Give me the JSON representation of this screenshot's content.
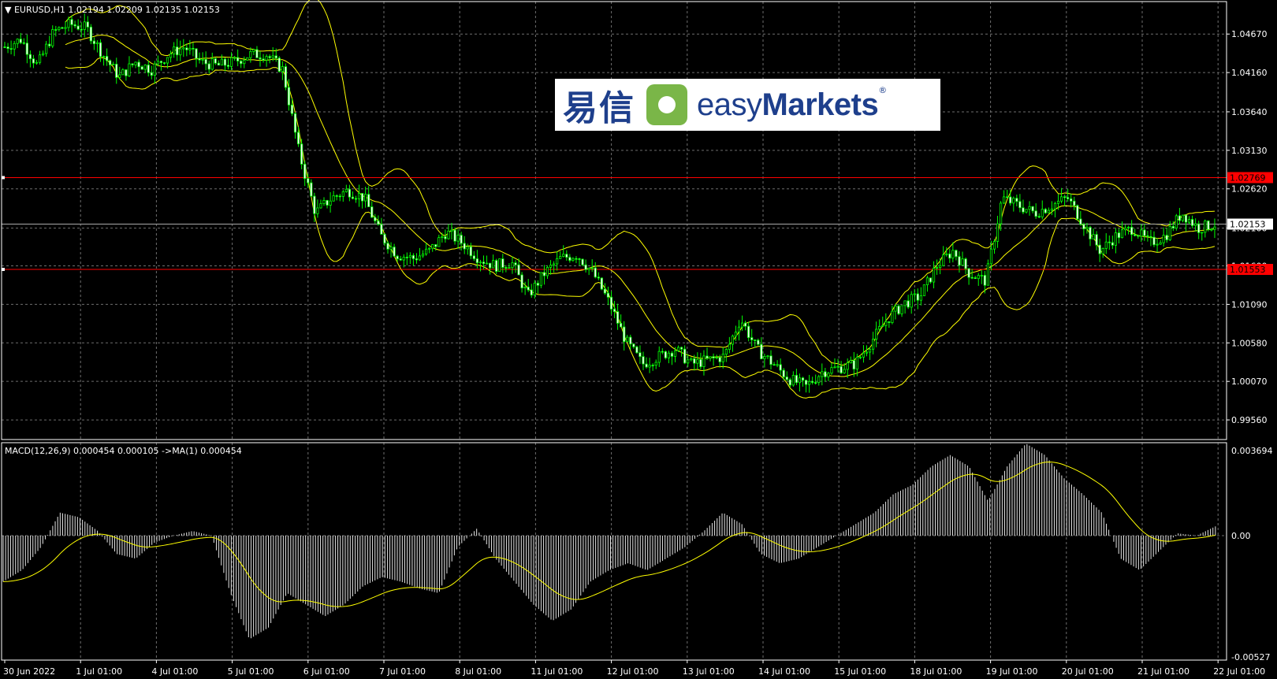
{
  "window": {
    "symbol_title": "EURUSD,H1",
    "ohlc": "1.02194 1.02209 1.02135 1.02153"
  },
  "logo": {
    "brand_cn": "易信",
    "brand_en_a": "easy",
    "brand_en_b": "Markets",
    "reg": "®"
  },
  "chart_data": [
    {
      "type": "candlestick",
      "title": "EURUSD,H1",
      "y_ticks": [
        "1.04670",
        "1.04160",
        "1.03640",
        "1.03130",
        "1.02620",
        "1.02100",
        "1.01600",
        "1.01090",
        "1.00580",
        "1.00070",
        "0.99560"
      ],
      "ylim": [
        0.993,
        1.051
      ],
      "current_price": "1.02153",
      "hlines": [
        {
          "value": 1.02769,
          "label": "1.02769",
          "color": "#ff0000"
        },
        {
          "value": 1.01553,
          "label": "1.01553",
          "color": "#ff0000"
        }
      ],
      "x_ticks": [
        "30 Jun 2022",
        "1 Jul 01:00",
        "4 Jul 01:00",
        "5 Jul 01:00",
        "6 Jul 01:00",
        "7 Jul 01:00",
        "8 Jul 01:00",
        "11 Jul 01:00",
        "12 Jul 01:00",
        "13 Jul 01:00",
        "14 Jul 01:00",
        "15 Jul 01:00",
        "18 Jul 01:00",
        "19 Jul 01:00",
        "20 Jul 01:00",
        "21 Jul 01:00",
        "22 Jul 01:00"
      ],
      "price_path": [
        1.045,
        1.046,
        1.0425,
        1.047,
        1.048,
        1.0475,
        1.044,
        1.041,
        1.043,
        1.042,
        1.044,
        1.045,
        1.043,
        1.0425,
        1.043,
        1.044,
        1.044,
        1.042,
        1.031,
        1.023,
        1.025,
        1.026,
        1.025,
        1.02,
        1.0175,
        1.017,
        1.018,
        1.0205,
        1.019,
        1.017,
        1.016,
        1.0165,
        1.012,
        1.015,
        1.017,
        1.0175,
        1.015,
        1.011,
        1.006,
        1.003,
        1.004,
        1.005,
        1.003,
        1.0035,
        1.004,
        1.009,
        1.005,
        1.003,
        1.001,
        1.0,
        1.002,
        1.0025,
        1.003,
        1.006,
        1.009,
        1.011,
        1.012,
        1.016,
        1.018,
        1.015,
        1.014,
        1.025,
        1.024,
        1.023,
        1.024,
        1.025,
        1.0215,
        1.018,
        1.02,
        1.021,
        1.019,
        1.02,
        1.023,
        1.021,
        1.0215
      ],
      "series": [
        {
          "name": "Bollinger Bands",
          "color": "#ffff00"
        }
      ]
    },
    {
      "type": "histogram",
      "title": "MACD(12,26,9) 0.000454 0.000105 ->MA(1) 0.000454",
      "y_ticks": [
        "0.003694",
        "0.00",
        "-0.00527"
      ],
      "ylim": [
        -0.00527,
        0.003694
      ],
      "macd_path": [
        -0.002,
        -0.0015,
        -0.0005,
        0.001,
        0.0008,
        0.0002,
        -0.0008,
        -0.001,
        -0.0003,
        0.0,
        0.0002,
        0.0,
        -0.0025,
        -0.0045,
        -0.004,
        -0.0025,
        -0.003,
        -0.0035,
        -0.003,
        -0.0022,
        -0.0018,
        -0.002,
        -0.0023,
        -0.0025,
        -0.0005,
        0.0003,
        -0.001,
        -0.002,
        -0.003,
        -0.0037,
        -0.0032,
        -0.002,
        -0.0015,
        -0.0012,
        -0.0015,
        -0.001,
        -0.0005,
        0.0002,
        0.001,
        0.0005,
        -0.0008,
        -0.0012,
        -0.001,
        -0.0005,
        0.0,
        0.0005,
        0.001,
        0.0018,
        0.0022,
        0.003,
        0.0035,
        0.003,
        0.0015,
        0.003,
        0.004,
        0.0035,
        0.0025,
        0.0018,
        0.001,
        -0.001,
        -0.0015,
        -0.0007,
        0.0001,
        0.0,
        0.0004
      ],
      "series": [
        {
          "name": "MACD",
          "color": "#ffffff"
        },
        {
          "name": "Signal",
          "color": "#ffff00"
        }
      ]
    }
  ]
}
